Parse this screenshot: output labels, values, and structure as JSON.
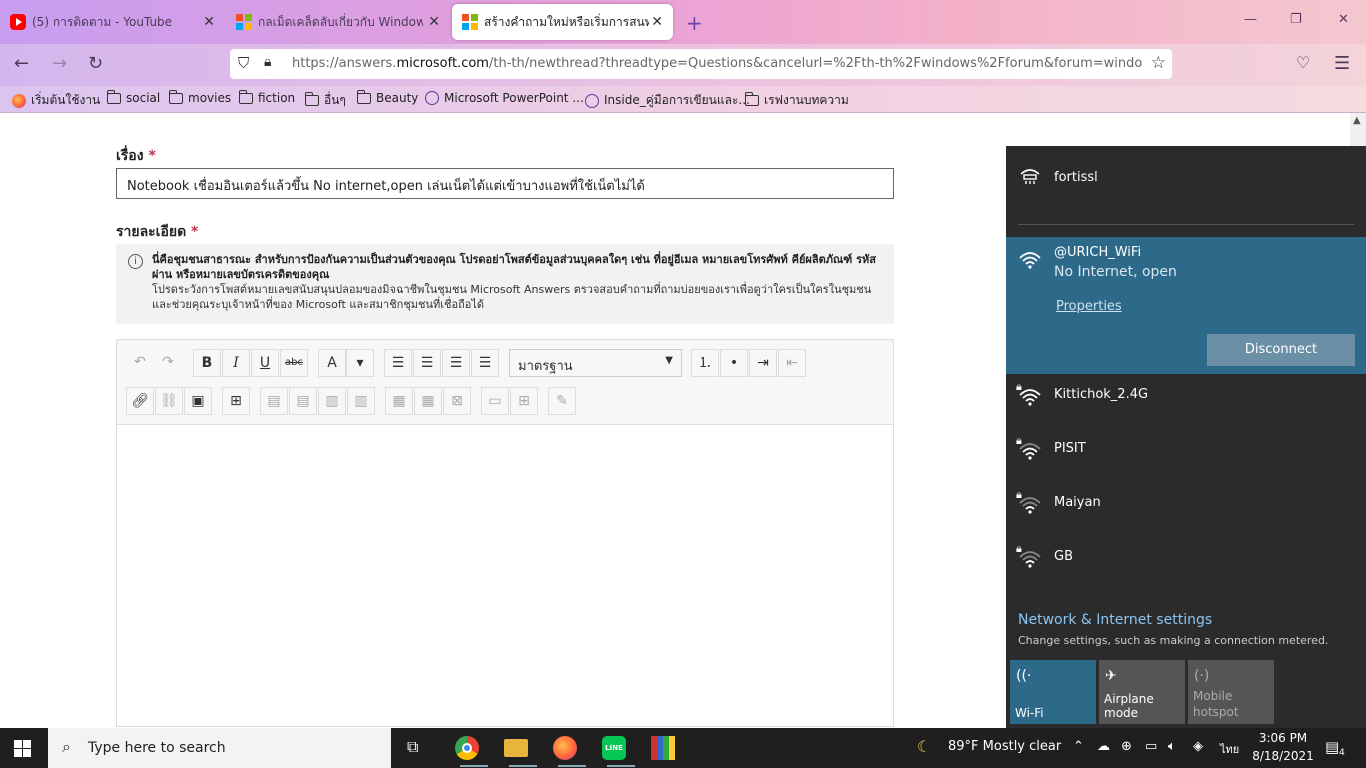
{
  "browser": {
    "tabs": [
      {
        "title": "(5) การติดตาม - YouTube",
        "icon": "youtube-icon"
      },
      {
        "title": "กลเม็ดเคล็ดลับเกี่ยวกับ Windows",
        "icon": "microsoft-icon"
      },
      {
        "title": "สร้างคำถามใหม่หรือเริ่มการสนทนา",
        "icon": "microsoft-icon"
      }
    ],
    "url_prefix": "https://answers.",
    "url_domain": "microsoft.com",
    "url_rest": "/th-th/newthread?threadtype=Questions&cancelurl=%2Fth-th%2Fwindows%2Fforum&forum=windows&filt",
    "bookmarks": [
      "เริ่มต้นใช้งาน",
      "social",
      "movies",
      "fiction",
      "อื่นๆ",
      "Beauty",
      "Microsoft PowerPoint ...",
      "Inside_คู่มือการเขียนและ...",
      "เรฟงานบทความ"
    ]
  },
  "form": {
    "subject_label": "เรื่อง",
    "required_mark": "*",
    "subject_value": "Notebook เชื่อมอินเตอร์แล้วขึ้น No internet,open เล่นเน็ตได้แต่เข้าบางแอพที่ใช้เน็ตไม่ได้",
    "details_label": "รายละเอียด",
    "notice_info_glyph": "i",
    "notice_bold": "นี่คือชุมชนสาธารณะ สำหรับการป้องกันความเป็นส่วนตัวของคุณ โปรดอย่าโพสต์ข้อมูลส่วนบุคคลใดๆ เช่น ที่อยู่อีเมล หมายเลขโทรศัพท์ คีย์ผลิตภัณฑ์ รหัสผ่าน หรือหมายเลขบัตรเครดิตของคุณ",
    "notice_normal": "โปรดระวังการโพสต์หมายเลขสนับสนุนปลอมของมิจฉาชีพในชุมชน Microsoft Answers  ตรวจสอบคำถามที่ถามบ่อยของเราเพื่อดูว่าใครเป็นใครในชุมชนและช่วยคุณระบุเจ้าหน้าที่ของ Microsoft และสมาชิกชุมชนที่เชื่อถือได้",
    "font_select": "มาตรฐาน"
  },
  "toolbar_glyphs": {
    "bold": "B",
    "italic": "I",
    "underline": "U",
    "strike": "abc",
    "fontcolor": "A",
    "caret": "▾"
  },
  "network": {
    "wired": {
      "name": "fortissl"
    },
    "active": {
      "name": "@URICH_WiFi",
      "status": "No Internet, open",
      "properties": "Properties",
      "disconnect": "Disconnect"
    },
    "others": [
      "Kittichok_2.4G",
      "PISIT",
      "Maiyan",
      "GB"
    ],
    "settings_title": "Network & Internet settings",
    "settings_sub": "Change settings, such as making a connection metered.",
    "quick_actions": [
      {
        "label": "Wi-Fi",
        "on": true
      },
      {
        "label": "Airplane mode",
        "on": false
      },
      {
        "label": "Mobile hotspot",
        "on": false
      }
    ]
  },
  "taskbar": {
    "search_placeholder": "Type here to search",
    "weather": "89°F  Mostly clear",
    "lang": "ไทย",
    "time": "3:06 PM",
    "date": "8/18/2021",
    "notifications": "4"
  }
}
